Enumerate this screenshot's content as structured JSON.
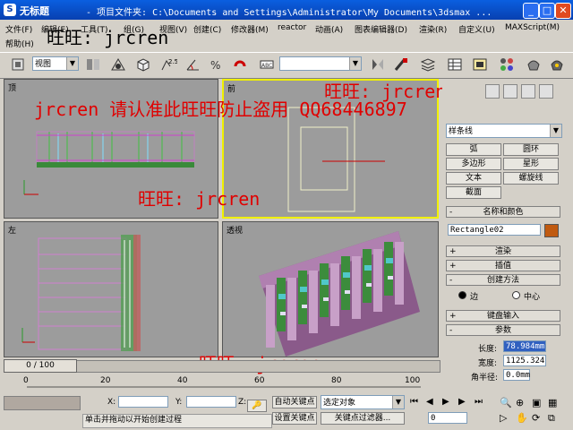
{
  "window": {
    "app_icon": "S",
    "title": "无标题",
    "path": "- 项目文件夹: C:\\Documents and Settings\\Administrator\\My Documents\\3dsmax ...",
    "minimize": "_",
    "maximize": "□",
    "close": "✕"
  },
  "menu": {
    "row1": [
      "文件(F)",
      "编辑(E)",
      "工具(T)",
      "组(G)",
      "视图(V)",
      "创建(C)",
      "修改器(M)",
      "reactor",
      "动画(A)",
      "图表编辑器(D)",
      "渲染(R)",
      "自定义(U)",
      "MAXScript(M)"
    ],
    "row2": [
      "帮助(H)"
    ]
  },
  "toolbar": {
    "view_combo": "视图",
    "selection_combo": "",
    "snap_value": "2.5"
  },
  "viewports": {
    "top": "顶",
    "front": "前",
    "left": "左",
    "perspective": "透视"
  },
  "watermarks": {
    "top_left": "旺旺: jrcren",
    "banner": "jrcren 请认准此旺旺防止盗用 QQ68446897",
    "top_right": "旺旺: jrcren",
    "middle": "旺旺: jrcren",
    "bottom": "旺旺: jrcren"
  },
  "command_panel": {
    "category_combo": "样条线",
    "buttons": [
      "弧",
      "圆环",
      "多边形",
      "星形",
      "文本",
      "螺旋线",
      "截面"
    ],
    "rollouts": {
      "name_color": "名称和颜色",
      "render": "渲染",
      "interpolation": "插值",
      "creation_method": "创建方法",
      "keyboard_entry": "键盘输入",
      "parameters": "参数"
    },
    "object_name": "Rectangle02",
    "creation": {
      "edge": "边",
      "center": "中心"
    },
    "params": {
      "length_label": "长度:",
      "length_value": "78.984mm",
      "width_label": "宽度:",
      "width_value": "1125.324",
      "corner_label": "角半径:",
      "corner_value": "0.0mm"
    },
    "colors": {
      "object_color": "#c05a10"
    }
  },
  "timeline": {
    "slider": "0 / 100",
    "ticks": [
      "0",
      "20",
      "40",
      "60",
      "80",
      "100"
    ]
  },
  "status": {
    "x_label": "X:",
    "y_label": "Y:",
    "z_label": "Z:",
    "auto_key": "自动关键点",
    "set_key": "设置关键点",
    "selected_combo": "选定对象",
    "key_filters": "关键点过滤器...",
    "frame_value": "0",
    "prompt": "单击并拖动以开始创建过程",
    "misc": "4"
  }
}
